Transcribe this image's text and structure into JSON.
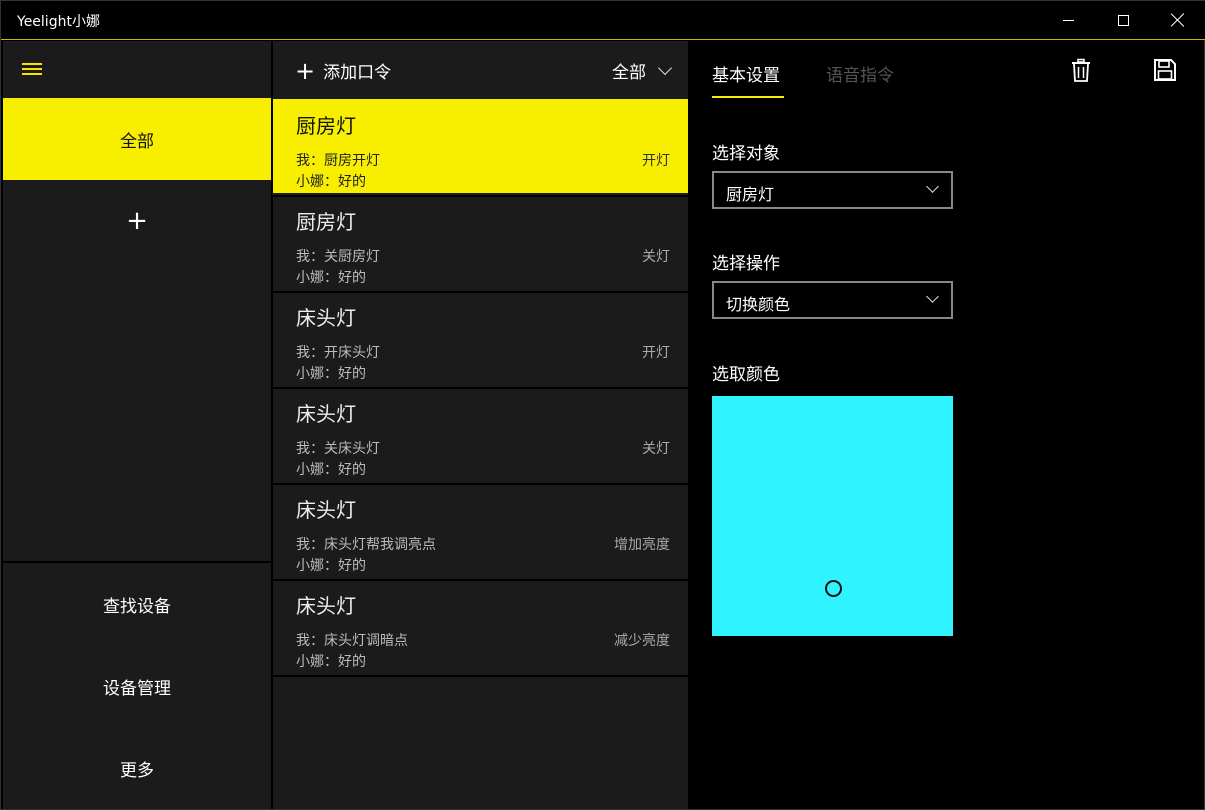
{
  "window": {
    "title": "Yeelight小娜"
  },
  "nav": {
    "menu_icon": "hamburger-icon",
    "selected_group": "全部",
    "add_label": "+",
    "bottom_items": [
      "查找设备",
      "设备管理",
      "更多"
    ]
  },
  "list": {
    "add_command_label": "添加口令",
    "add_icon": "plus-icon",
    "filter_label": "全部",
    "items": [
      {
        "device": "厨房灯",
        "me": "我：厨房开灯",
        "reply": "小娜：好的",
        "action": "开灯",
        "selected": true
      },
      {
        "device": "厨房灯",
        "me": "我：关厨房灯",
        "reply": "小娜：好的",
        "action": "关灯",
        "selected": false
      },
      {
        "device": "床头灯",
        "me": "我：开床头灯",
        "reply": "小娜：好的",
        "action": "开灯",
        "selected": false
      },
      {
        "device": "床头灯",
        "me": "我：关床头灯",
        "reply": "小娜：好的",
        "action": "关灯",
        "selected": false
      },
      {
        "device": "床头灯",
        "me": "我：床头灯帮我调亮点",
        "reply": "小娜：好的",
        "action": "增加亮度",
        "selected": false
      },
      {
        "device": "床头灯",
        "me": "我：床头灯调暗点",
        "reply": "小娜：好的",
        "action": "减少亮度",
        "selected": false
      }
    ]
  },
  "detail": {
    "tabs": [
      "基本设置",
      "语音指令"
    ],
    "active_tab": "基本设置",
    "delete_icon": "trash-icon",
    "save_icon": "save-icon",
    "target_label": "选择对象",
    "target_value": "厨房灯",
    "operation_label": "选择操作",
    "operation_value": "切换颜色",
    "color_label": "选取颜色",
    "selected_color": "#2ff3ff"
  },
  "colors": {
    "accent": "#f8ee00",
    "panel": "#1b1b1b",
    "background": "#000000"
  }
}
